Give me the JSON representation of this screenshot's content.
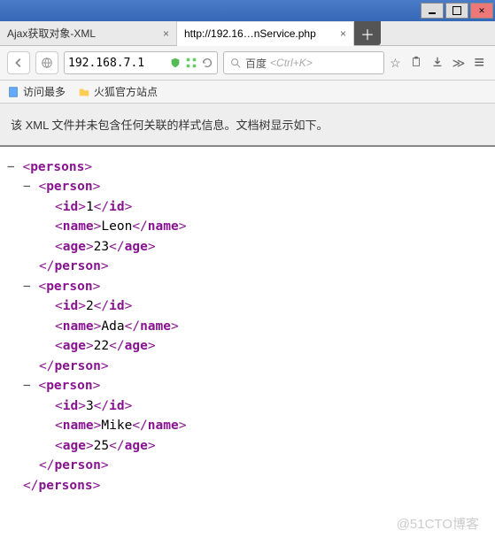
{
  "tabs": [
    {
      "title": "Ajax获取对象-XML",
      "active": false
    },
    {
      "title": "http://192.16…nService.php",
      "active": true
    }
  ],
  "address_bar": {
    "value": "192.168.7.1"
  },
  "search": {
    "engine": "百度",
    "placeholder": "<Ctrl+K>"
  },
  "bookmarks": [
    {
      "label": "访问最多"
    },
    {
      "label": "火狐官方站点"
    }
  ],
  "notice": "该 XML 文件并未包含任何关联的样式信息。文档树显示如下。",
  "xml": {
    "root": "persons",
    "items": [
      {
        "id": "1",
        "name": "Leon",
        "age": "23"
      },
      {
        "id": "2",
        "name": "Ada",
        "age": "22"
      },
      {
        "id": "3",
        "name": "Mike",
        "age": "25"
      }
    ],
    "child_tag": "person",
    "fields": [
      "id",
      "name",
      "age"
    ]
  },
  "watermark": "@51CTO博客"
}
